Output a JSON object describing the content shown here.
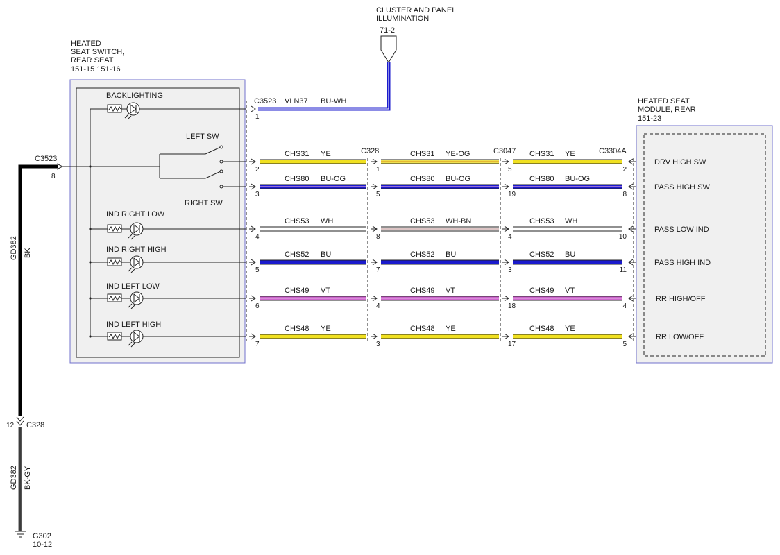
{
  "colors": {
    "blue": "#1a1acc",
    "yellow": "#f0e020",
    "yellow_og": "#eee050",
    "violet": "#cc66cc",
    "white_wire": "#ffffff",
    "wh_bn": "#c8a0a0",
    "black": "#000000",
    "bk_gy": "#555555",
    "box_fill": "#f0f0f0",
    "box_border": "#7070cc"
  },
  "top_source": {
    "title_line1": "CLUSTER AND PANEL",
    "title_line2": "ILLUMINATION",
    "ref": "71-2"
  },
  "switch": {
    "title_line1": "HEATED",
    "title_line2": "SEAT SWITCH,",
    "title_line3": "REAR SEAT",
    "refs": "151-15  151-16",
    "backlighting": "BACKLIGHTING",
    "left_sw": "LEFT SW",
    "right_sw": "RIGHT SW",
    "ind_right_low": "IND RIGHT LOW",
    "ind_right_high": "IND RIGHT HIGH",
    "ind_left_low": "IND LEFT LOW",
    "ind_left_high": "IND LEFT HIGH"
  },
  "module": {
    "title_line1": "HEATED SEAT",
    "title_line2": "MODULE, REAR",
    "ref": "151-23",
    "pins": [
      "DRV HIGH SW",
      "PASS HIGH SW",
      "PASS LOW IND",
      "PASS HIGH IND",
      "RR HIGH/OFF",
      "RR LOW/OFF"
    ]
  },
  "connectors": {
    "c3523": "C3523",
    "c328": "C328",
    "c3047": "C3047",
    "c3304a": "C3304A"
  },
  "backlight_wire": {
    "pin": "1",
    "circuit": "VLN37",
    "color": "BU-WH"
  },
  "ground": {
    "c3523_pin": "8",
    "circuit_upper": "GD382",
    "color_upper": "BK",
    "c328_pin": "12",
    "circuit_lower": "GD382",
    "color_lower": "BK-GY",
    "ground_ref": "G302",
    "ground_page": "10-12"
  },
  "wires": [
    {
      "seg1": {
        "circuit": "CHS31",
        "color": "YE"
      },
      "seg2": {
        "circuit": "CHS31",
        "color": "YE-OG"
      },
      "seg3": {
        "circuit": "CHS31",
        "color": "YE"
      },
      "pins": [
        "2",
        "1",
        "5",
        "2"
      ]
    },
    {
      "seg1": {
        "circuit": "CHS80",
        "color": "BU-OG"
      },
      "seg2": {
        "circuit": "CHS80",
        "color": "BU-OG"
      },
      "seg3": {
        "circuit": "CHS80",
        "color": "BU-OG"
      },
      "pins": [
        "3",
        "5",
        "19",
        "8"
      ]
    },
    {
      "seg1": {
        "circuit": "CHS53",
        "color": "WH"
      },
      "seg2": {
        "circuit": "CHS53",
        "color": "WH-BN"
      },
      "seg3": {
        "circuit": "CHS53",
        "color": "WH"
      },
      "pins": [
        "4",
        "8",
        "4",
        "10"
      ]
    },
    {
      "seg1": {
        "circuit": "CHS52",
        "color": "BU"
      },
      "seg2": {
        "circuit": "CHS52",
        "color": "BU"
      },
      "seg3": {
        "circuit": "CHS52",
        "color": "BU"
      },
      "pins": [
        "5",
        "7",
        "3",
        "11"
      ]
    },
    {
      "seg1": {
        "circuit": "CHS49",
        "color": "VT"
      },
      "seg2": {
        "circuit": "CHS49",
        "color": "VT"
      },
      "seg3": {
        "circuit": "CHS49",
        "color": "VT"
      },
      "pins": [
        "6",
        "4",
        "18",
        "4"
      ]
    },
    {
      "seg1": {
        "circuit": "CHS48",
        "color": "YE"
      },
      "seg2": {
        "circuit": "CHS48",
        "color": "YE"
      },
      "seg3": {
        "circuit": "CHS48",
        "color": "YE"
      },
      "pins": [
        "7",
        "3",
        "17",
        "5"
      ]
    }
  ]
}
